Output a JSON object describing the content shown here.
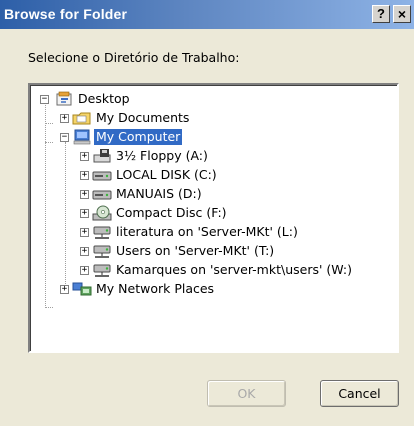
{
  "window": {
    "title": "Browse for Folder",
    "help_glyph": "?",
    "close_glyph": "×"
  },
  "prompt": "Selecione o Diretório de Trabalho:",
  "tree": {
    "root": {
      "label": "Desktop",
      "expander": "−",
      "icon": "desktop-icon"
    },
    "my_documents": {
      "label": "My Documents",
      "expander": "+",
      "icon": "my-documents-icon"
    },
    "my_computer": {
      "label": "My Computer",
      "expander": "−",
      "icon": "my-computer-icon",
      "selected": true
    },
    "drives": [
      {
        "label": "3½ Floppy (A:)",
        "expander": "+",
        "icon": "floppy-drive-icon"
      },
      {
        "label": "LOCAL DISK (C:)",
        "expander": "+",
        "icon": "hard-disk-icon"
      },
      {
        "label": "MANUAIS (D:)",
        "expander": "+",
        "icon": "hard-disk-icon"
      },
      {
        "label": "Compact Disc (F:)",
        "expander": "+",
        "icon": "cd-drive-icon"
      },
      {
        "label": "literatura on 'Server-MKt' (L:)",
        "expander": "+",
        "icon": "network-drive-icon"
      },
      {
        "label": "Users on 'Server-MKt' (T:)",
        "expander": "+",
        "icon": "network-drive-icon"
      },
      {
        "label": "Kamarques on 'server-mkt\\users' (W:)",
        "expander": "+",
        "icon": "network-drive-icon"
      }
    ],
    "network": {
      "label": "My Network Places",
      "expander": "+",
      "icon": "network-places-icon"
    }
  },
  "buttons": {
    "ok": "OK",
    "cancel": "Cancel"
  },
  "colors": {
    "selection": "#316ac5",
    "dialog_bg": "#ece9d8",
    "title_bar": "#5e86c1"
  }
}
